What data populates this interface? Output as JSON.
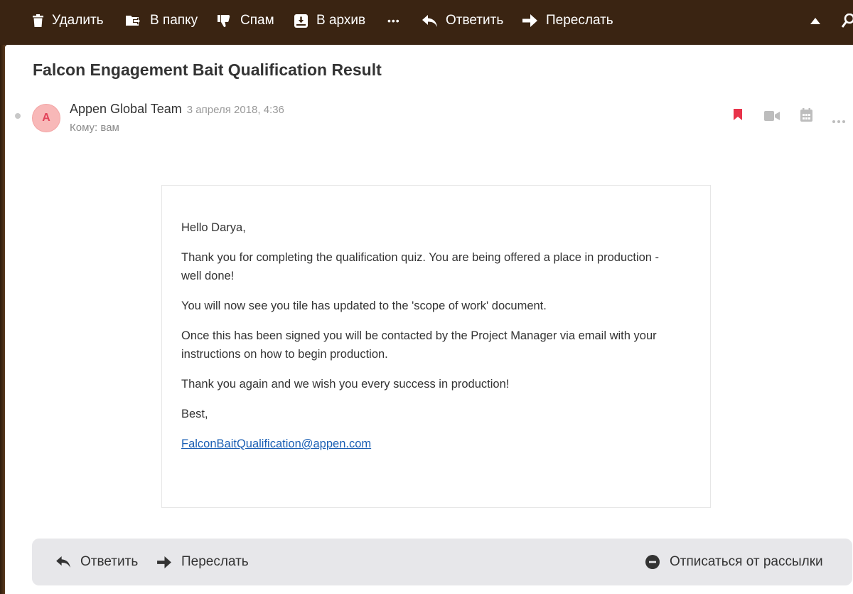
{
  "toolbar": {
    "delete_label": "Удалить",
    "to_folder_label": "В папку",
    "spam_label": "Спам",
    "archive_label": "В архив",
    "more_label": "•••",
    "reply_label": "Ответить",
    "forward_label": "Переслать"
  },
  "message": {
    "subject": "Falcon Engagement Bait Qualification Result",
    "avatar_letter": "A",
    "sender": "Appen Global Team",
    "date": "3 апреля 2018, 4:36",
    "to": "Кому: вам",
    "body": {
      "greeting": "Hello Darya,",
      "p1": "Thank you for completing the qualification quiz. You are being offered a place in production - well done!",
      "p2": "You will now see you tile has updated to the 'scope of work' document.",
      "p3": "Once this has been signed you will be contacted by the Project Manager via email with your instructions on how to begin production.",
      "p4": "Thank you again and we wish you every success in production!",
      "closing": "Best,",
      "email_link": "FalconBaitQualification@appen.com"
    }
  },
  "bottom_bar": {
    "reply_label": "Ответить",
    "forward_label": "Переслать",
    "unsubscribe_label": "Отписаться от рассылки"
  },
  "icons": {
    "toolbar": [
      "trash-icon",
      "folder-move-icon",
      "thumbs-down-icon",
      "archive-icon",
      "more-icon",
      "reply-icon",
      "forward-icon",
      "collapse-up-icon",
      "search-icon"
    ],
    "header": [
      "bookmark-icon",
      "video-icon",
      "calendar-icon",
      "more-icon"
    ],
    "bottom": [
      "reply-icon",
      "forward-icon",
      "unsubscribe-icon"
    ]
  },
  "colors": {
    "toolbar_bg": "#3a2412",
    "bookmark": "#e8334a",
    "link": "#1a5fb4",
    "avatar_bg": "#f8b8b8",
    "avatar_text": "#e2435a"
  }
}
